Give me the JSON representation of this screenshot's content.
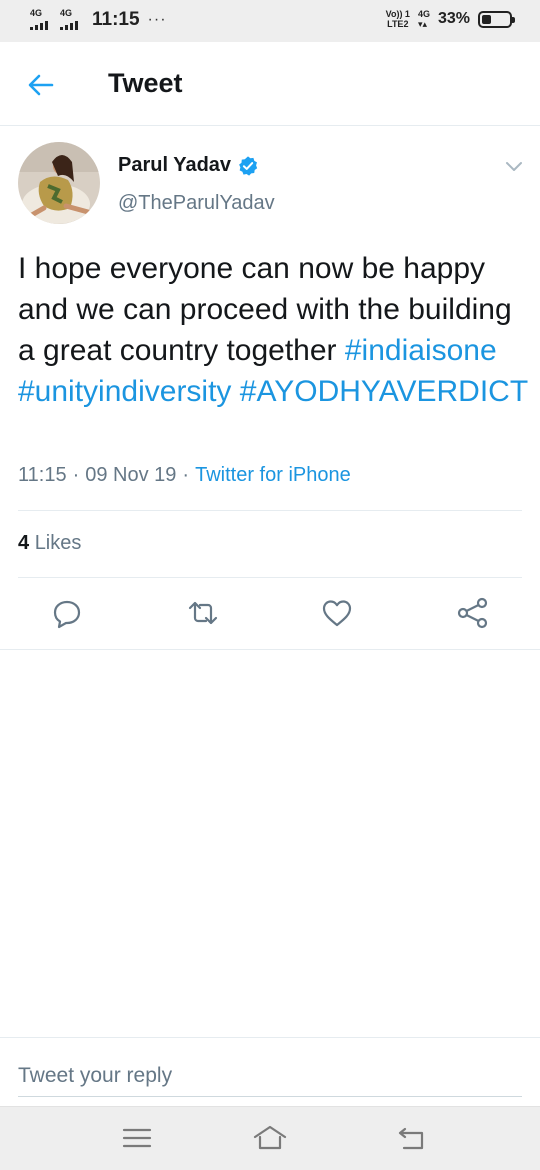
{
  "status_bar": {
    "network1": "4G",
    "network2": "4G",
    "time": "11:15",
    "dots": "···",
    "volte_top": "Vo)) 1",
    "volte_bottom": "LTE2",
    "fourg_top": "4G",
    "fourg_bottom": "▾▴",
    "battery_percent": "33%",
    "battery_level": 0.33
  },
  "header": {
    "back_icon": "arrow-left-icon",
    "title": "Tweet"
  },
  "tweet": {
    "author_name": "Parul Yadav",
    "verified": true,
    "handle": "@TheParulYadav",
    "text_plain": "I hope everyone can now be happy and we can proceed with the building a great country together",
    "hashtags": [
      "#indiaisone",
      "#unityindiversity",
      "#AYODHYAVERDICT"
    ],
    "time": "11:15",
    "separator": "·",
    "date": "09 Nov 19",
    "source": "Twitter for iPhone",
    "likes_count": "4",
    "likes_label": "Likes"
  },
  "actions": [
    {
      "name": "reply",
      "icon": "reply-icon"
    },
    {
      "name": "retweet",
      "icon": "retweet-icon"
    },
    {
      "name": "like",
      "icon": "heart-icon"
    },
    {
      "name": "share",
      "icon": "share-icon"
    }
  ],
  "reply": {
    "placeholder": "Tweet your reply"
  },
  "nav": {
    "menu_icon": "menu-icon",
    "home_icon": "home-icon",
    "back_icon": "back-icon"
  },
  "colors": {
    "accent": "#1da1f2",
    "link": "#1b95e0",
    "text": "#14171a",
    "muted": "#657786",
    "divider": "#e6ecf0",
    "statusbar": "#eeeeee"
  }
}
